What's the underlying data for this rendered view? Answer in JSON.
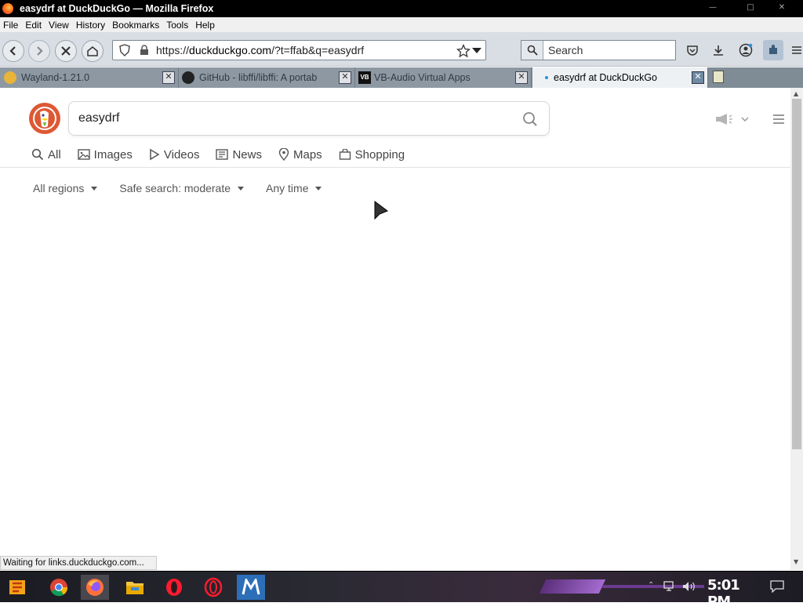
{
  "window": {
    "title": "easydrf at DuckDuckGo — Mozilla Firefox"
  },
  "menu": [
    "File",
    "Edit",
    "View",
    "History",
    "Bookmarks",
    "Tools",
    "Help"
  ],
  "nav": {
    "url_prefix": "https://",
    "url_domain": "duckduckgo.com",
    "url_rest": "/?t=ffab&q=easydrf",
    "search_placeholder": "Search"
  },
  "tabs": [
    {
      "label": "Wayland-1.21.0"
    },
    {
      "label": "GitHub - libffi/libffi: A portab"
    },
    {
      "label": "VB-Audio Virtual Apps"
    },
    {
      "label": "easydrf at DuckDuckGo"
    }
  ],
  "ddg": {
    "query": "easydrf",
    "tabs": [
      "All",
      "Images",
      "Videos",
      "News",
      "Maps",
      "Shopping"
    ],
    "filters": [
      "All regions",
      "Safe search: moderate",
      "Any time"
    ]
  },
  "status": "Waiting for links.duckduckgo.com...",
  "taskbar": {
    "clock": "5:01 PM"
  },
  "colors": {
    "ddg_orange": "#de5833",
    "tab_bar": "#7f8c96",
    "nav_bg": "#d9dee4"
  }
}
